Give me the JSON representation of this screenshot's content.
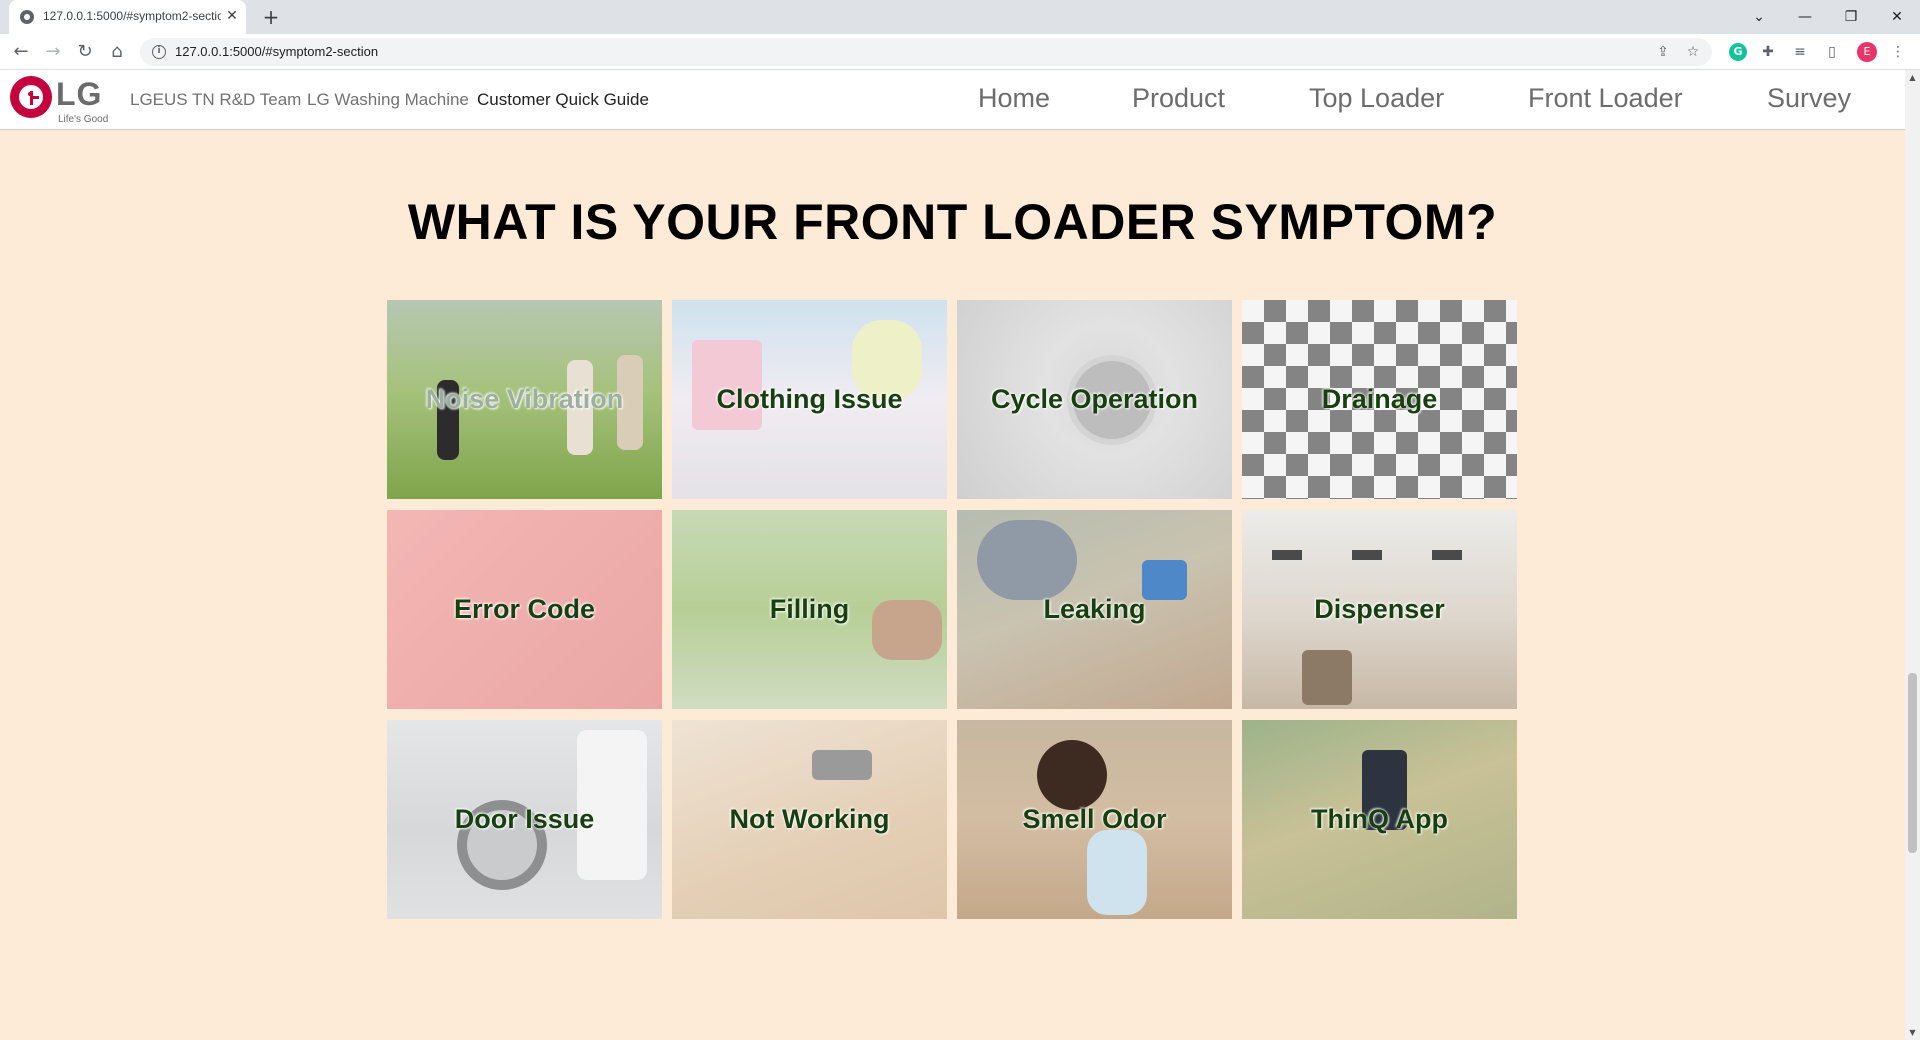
{
  "browser": {
    "tab_title": "127.0.0.1:5000/#symptom2-section",
    "tab_close": "✕",
    "new_tab": "+",
    "url": "127.0.0.1:5000/#symptom2-section",
    "profile_initial": "E",
    "window_controls": {
      "chevron": "⌄",
      "minimize": "—",
      "restore": "❐",
      "close": "✕"
    }
  },
  "site_nav": {
    "brand": {
      "word": "LG",
      "tagline": "Life's Good"
    },
    "brand_links": [
      "LGEUS TN R&D Team",
      "LG Washing Machine",
      "Customer Quick Guide"
    ],
    "main_links": [
      "Home",
      "Product",
      "Top Loader",
      "Front Loader",
      "Survey"
    ]
  },
  "section": {
    "title": "WHAT IS YOUR FRONT LOADER SYMPTOM?",
    "tiles": [
      {
        "label": "Noise Vibration"
      },
      {
        "label": "Clothing Issue"
      },
      {
        "label": "Cycle Operation"
      },
      {
        "label": "Drainage"
      },
      {
        "label": "Error Code"
      },
      {
        "label": "Filling"
      },
      {
        "label": "Leaking"
      },
      {
        "label": "Dispenser"
      },
      {
        "label": "Door Issue"
      },
      {
        "label": "Not Working"
      },
      {
        "label": "Smell Odor"
      },
      {
        "label": "ThinQ App"
      }
    ]
  },
  "colors": {
    "page_background": "#fdebd8",
    "tile_label": "#173f0f",
    "lg_red": "#c5003e"
  }
}
